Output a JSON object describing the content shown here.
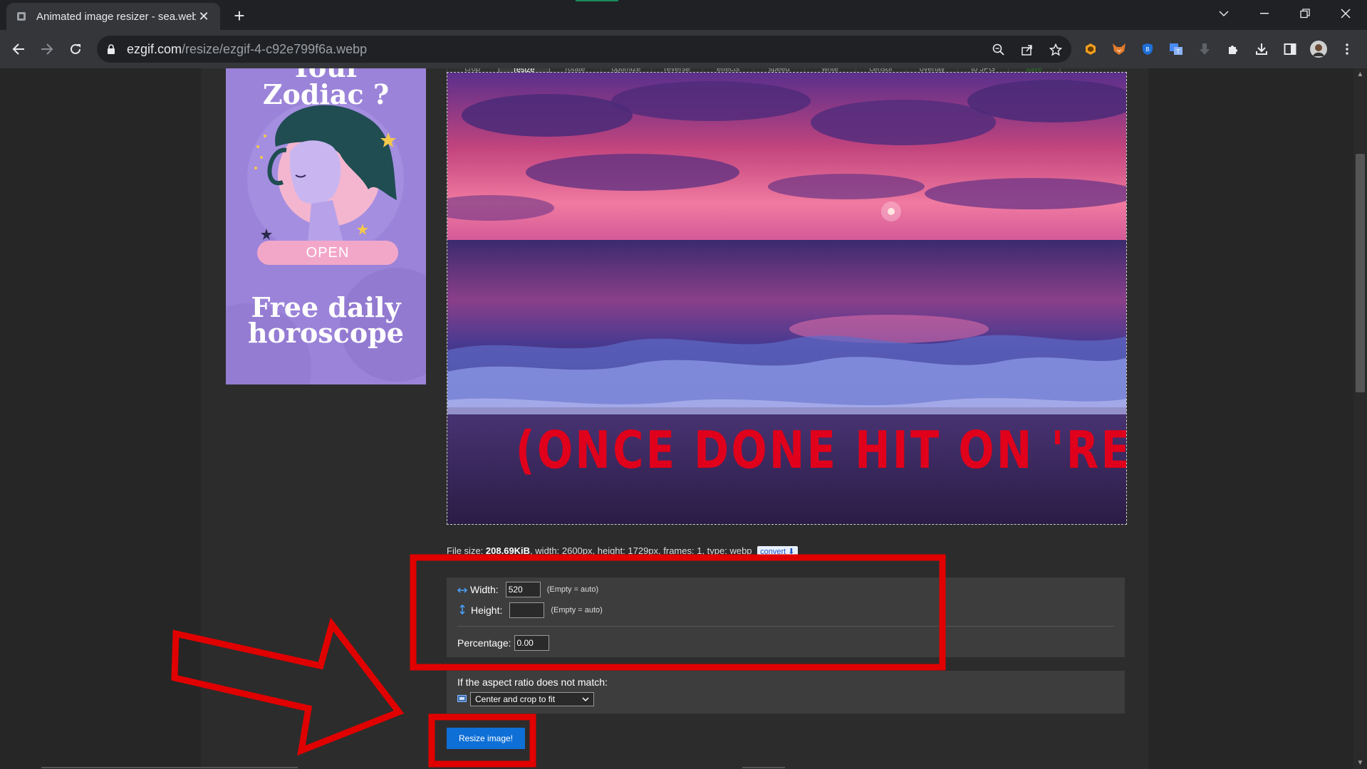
{
  "browser": {
    "tab_title": "Animated image resizer - sea.webp",
    "tab_close": "✕",
    "new_tab": "+",
    "url_host": "ezgif.com",
    "url_path": "/resize/ezgif-4-c92e799f6a.webp"
  },
  "ad": {
    "title_line1": "Your",
    "title_line2": "Zodiac ?",
    "open_label": "OPEN",
    "tagline_line1": "Free daily",
    "tagline_line2": "horoscope"
  },
  "tools": {
    "items": [
      "crop",
      "resize",
      "rotate",
      "optimize",
      "reverse",
      "effects",
      "speed",
      "write",
      "censor",
      "overlay",
      "to JPG",
      "save"
    ],
    "active": "resize"
  },
  "image": {
    "overlay_text": "(ONCE DONE HIT ON 'RESIZE IMAGE')"
  },
  "fileinfo": {
    "prefix": "File size: ",
    "size": "208.69KiB",
    "rest": ", width: 2600px, height: 1729px, frames: 1, type: webp",
    "convert_label": "convert"
  },
  "form": {
    "width_label": "Width:",
    "width_value": "520",
    "width_hint": "(Empty = auto)",
    "height_label": "Height:",
    "height_value": "",
    "height_hint": "(Empty = auto)",
    "percentage_label": "Percentage:",
    "percentage_value": "0.00",
    "aspect_label": "If the aspect ratio does not match:",
    "aspect_selected": "Center and crop to fit",
    "submit_label": "Resize image!"
  },
  "colors": {
    "annotation_red": "#e00000",
    "button_blue": "#0e6fd6",
    "ad_purple": "#9b83d9"
  }
}
